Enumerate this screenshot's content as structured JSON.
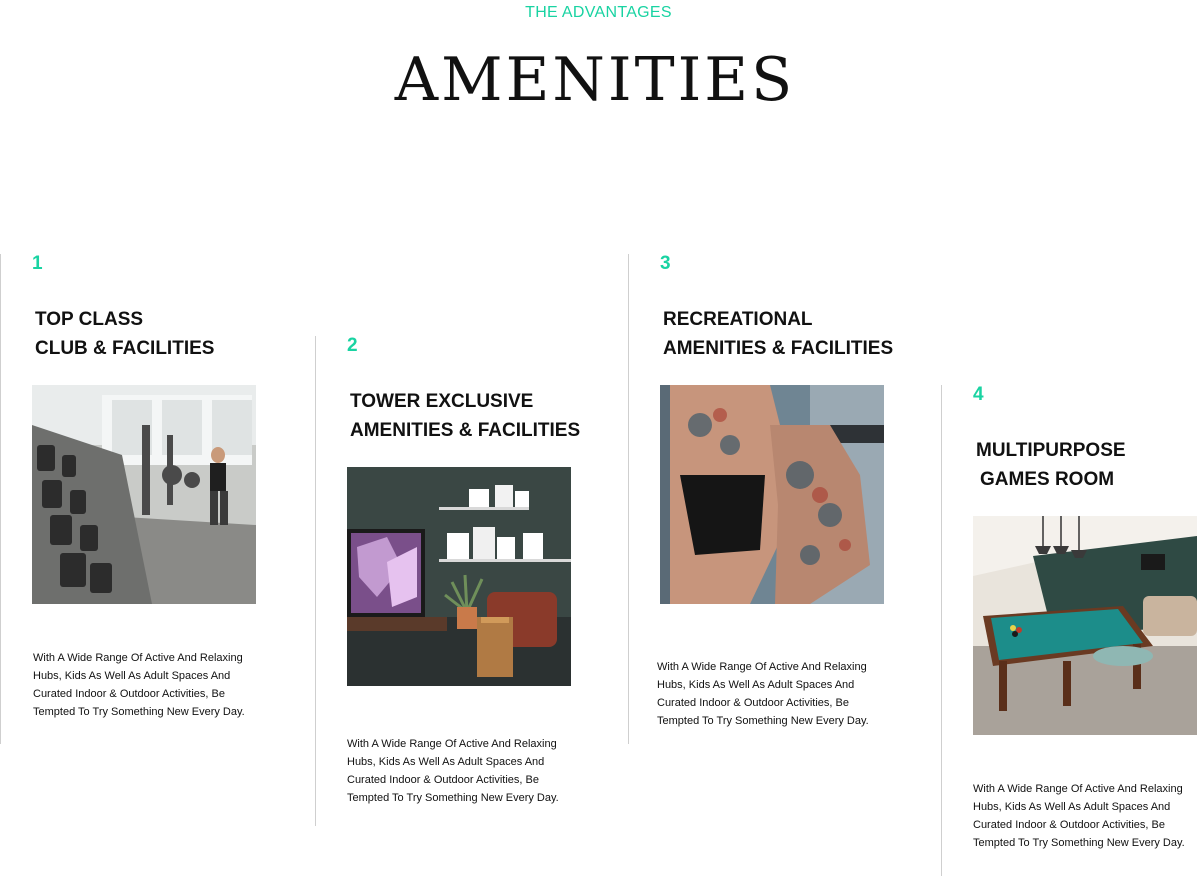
{
  "section": {
    "eyebrow": "THE ADVANTAGES",
    "title": "AMENITIES"
  },
  "colors": {
    "accent": "#19d3a2"
  },
  "cards": [
    {
      "number": "1",
      "heading_line1": "TOP CLASS",
      "heading_line2": "CLUB & FACILITIES",
      "image": "gym-dumbbell-rack-photo",
      "description": "With A Wide Range Of Active And Relaxing Hubs, Kids As Well As Adult Spaces And Curated Indoor & Outdoor Activities, Be Tempted To Try Something New Every Day."
    },
    {
      "number": "2",
      "heading_line1": "TOWER EXCLUSIVE",
      "heading_line2": "AMENITIES & FACILITIES",
      "image": "lounge-interior-photo",
      "description": "With A Wide Range Of Active And Relaxing Hubs, Kids As Well As Adult Spaces And Curated Indoor & Outdoor Activities, Be Tempted To Try Something New Every Day."
    },
    {
      "number": "3",
      "heading_line1": "RECREATIONAL",
      "heading_line2": "AMENITIES & FACILITIES",
      "image": "weightlifter-barbell-photo",
      "description": "With A Wide Range Of Active And Relaxing Hubs, Kids As Well As Adult Spaces And Curated Indoor & Outdoor Activities, Be Tempted To Try Something New Every Day."
    },
    {
      "number": "4",
      "heading_line1": "MULTIPURPOSE",
      "heading_line2": "GAMES ROOM",
      "image": "billiards-games-room-photo",
      "description": "With A Wide Range Of Active And Relaxing Hubs, Kids As Well As Adult Spaces And Curated Indoor & Outdoor Activities, Be Tempted To Try Something New Every Day."
    }
  ]
}
